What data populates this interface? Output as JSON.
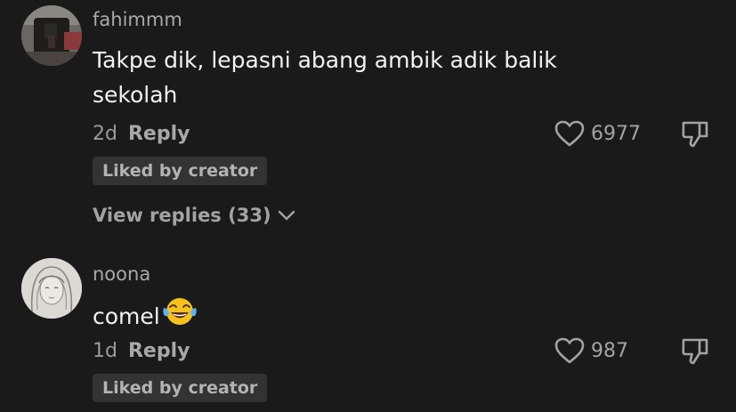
{
  "comments": [
    {
      "username": "fahimmm",
      "text_line1": "Takpe dik, lepasni abang ambik adik balik",
      "text_line2": "sekolah",
      "age": "2d",
      "reply_label": "Reply",
      "likes": "6977",
      "liked_badge": "Liked by creator",
      "view_replies": "View replies (33)"
    },
    {
      "username": "noona",
      "text": "comel",
      "emoji": "face-with-tears-of-joy",
      "age": "1d",
      "reply_label": "Reply",
      "likes": "987",
      "liked_badge": "Liked by creator"
    }
  ],
  "colors": {
    "background": "#1a1a1a",
    "badge_bg": "#333333",
    "muted_text": "#a3a3a3"
  }
}
